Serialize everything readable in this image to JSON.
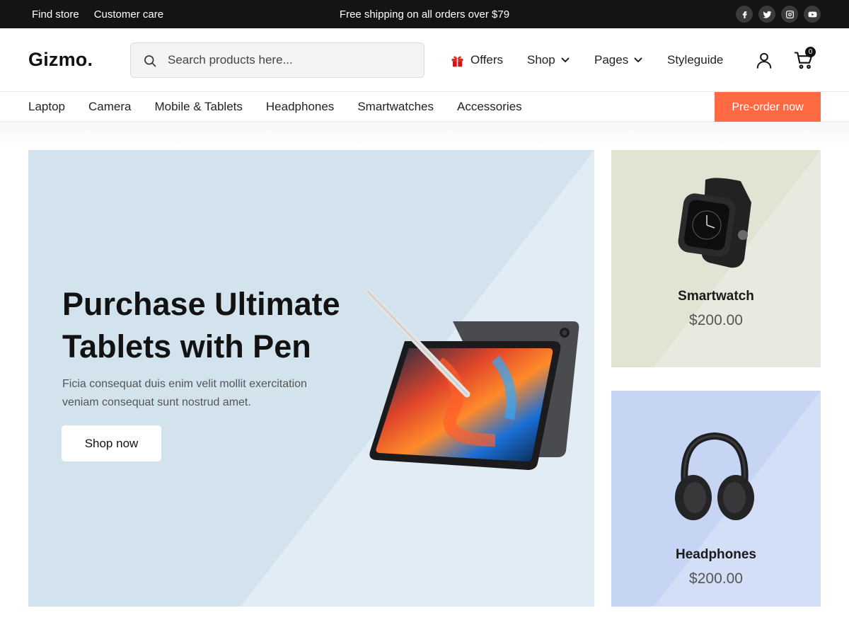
{
  "topbar": {
    "links": [
      "Find store",
      "Customer care"
    ],
    "promo": "Free shipping on all orders over $79",
    "social": [
      "facebook-icon",
      "twitter-icon",
      "instagram-icon",
      "youtube-icon"
    ]
  },
  "header": {
    "logo": "Gizmo.",
    "search_placeholder": "Search products here...",
    "nav": {
      "offers": "Offers",
      "shop": "Shop",
      "pages": "Pages",
      "styleguide": "Styleguide"
    },
    "cart_count": "0"
  },
  "categories": [
    "Laptop",
    "Camera",
    "Mobile & Tablets",
    "Headphones",
    "Smartwatches",
    "Accessories"
  ],
  "preorder_label": "Pre-order now",
  "hero": {
    "title": "Purchase Ultimate Tablets with Pen",
    "description": "Ficia consequat duis enim velit mollit exercitation veniam consequat sunt nostrud amet.",
    "button": "Shop now"
  },
  "cards": [
    {
      "title": "Smartwatch",
      "price": "$200.00"
    },
    {
      "title": "Headphones",
      "price": "$200.00"
    }
  ],
  "colors": {
    "topbar": "#141414",
    "accent": "#ff6a45",
    "hero_bg": "#d2e3ee",
    "card_watch_bg": "#e0e4d3",
    "card_phones_bg": "#c6d5f4"
  }
}
